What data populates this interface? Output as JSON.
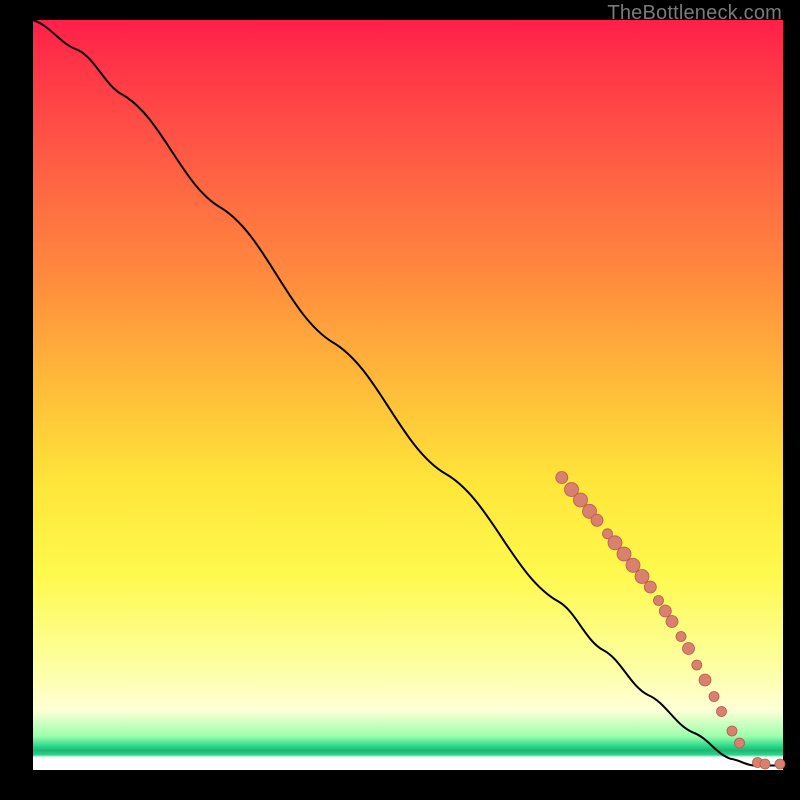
{
  "attribution": "TheBottleneck.com",
  "colors": {
    "marker_fill": "#d9806f",
    "marker_stroke": "#b55a4e",
    "line": "#000000"
  },
  "chart_data": {
    "type": "line",
    "title": "",
    "xlabel": "",
    "ylabel": "",
    "xlim": [
      0,
      100
    ],
    "ylim": [
      0,
      100
    ],
    "grid": false,
    "legend": false,
    "line_points": [
      {
        "x": 0,
        "y": 100
      },
      {
        "x": 6,
        "y": 96
      },
      {
        "x": 12,
        "y": 90
      },
      {
        "x": 25,
        "y": 75
      },
      {
        "x": 40,
        "y": 57
      },
      {
        "x": 55,
        "y": 39.5
      },
      {
        "x": 70,
        "y": 22.5
      },
      {
        "x": 76,
        "y": 16
      },
      {
        "x": 82,
        "y": 10
      },
      {
        "x": 88,
        "y": 5
      },
      {
        "x": 93,
        "y": 1.5
      },
      {
        "x": 96,
        "y": 0.6
      },
      {
        "x": 100,
        "y": 0.6
      }
    ],
    "markers": [
      {
        "x": 70.5,
        "y": 39.0,
        "r": 6
      },
      {
        "x": 71.8,
        "y": 37.4,
        "r": 7
      },
      {
        "x": 73.0,
        "y": 36.0,
        "r": 7
      },
      {
        "x": 74.2,
        "y": 34.5,
        "r": 7
      },
      {
        "x": 75.2,
        "y": 33.3,
        "r": 6
      },
      {
        "x": 76.6,
        "y": 31.5,
        "r": 5
      },
      {
        "x": 77.6,
        "y": 30.3,
        "r": 7
      },
      {
        "x": 78.8,
        "y": 28.8,
        "r": 7
      },
      {
        "x": 80.0,
        "y": 27.3,
        "r": 7
      },
      {
        "x": 81.2,
        "y": 25.8,
        "r": 7
      },
      {
        "x": 82.3,
        "y": 24.4,
        "r": 6
      },
      {
        "x": 83.4,
        "y": 22.6,
        "r": 5
      },
      {
        "x": 84.3,
        "y": 21.2,
        "r": 6
      },
      {
        "x": 85.2,
        "y": 19.8,
        "r": 6
      },
      {
        "x": 86.4,
        "y": 17.8,
        "r": 5
      },
      {
        "x": 87.4,
        "y": 16.2,
        "r": 6
      },
      {
        "x": 88.5,
        "y": 14.0,
        "r": 5
      },
      {
        "x": 89.6,
        "y": 12.0,
        "r": 6
      },
      {
        "x": 90.8,
        "y": 9.8,
        "r": 5
      },
      {
        "x": 91.8,
        "y": 7.8,
        "r": 5
      },
      {
        "x": 93.2,
        "y": 5.2,
        "r": 5
      },
      {
        "x": 94.2,
        "y": 3.6,
        "r": 5
      },
      {
        "x": 96.6,
        "y": 1.0,
        "r": 5
      },
      {
        "x": 97.6,
        "y": 0.8,
        "r": 5
      },
      {
        "x": 99.6,
        "y": 0.8,
        "r": 5
      }
    ]
  }
}
